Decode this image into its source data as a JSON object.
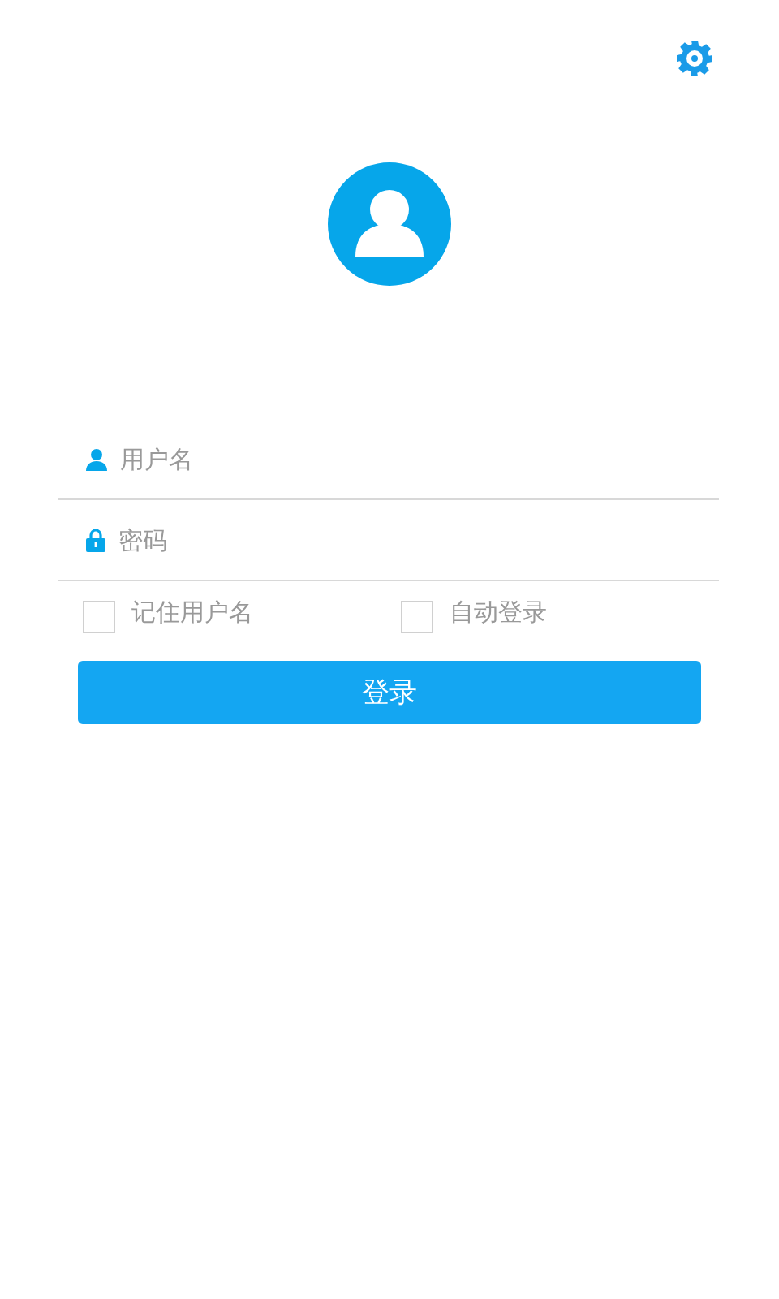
{
  "fields": [
    {
      "kind": "username",
      "placeholder": "用户名"
    },
    {
      "kind": "password",
      "placeholder": "密码"
    }
  ],
  "options": [
    {
      "label": "记住用户名",
      "checked": false
    },
    {
      "label": "自动登录",
      "checked": false
    }
  ],
  "login_button": {
    "label": "登录"
  }
}
